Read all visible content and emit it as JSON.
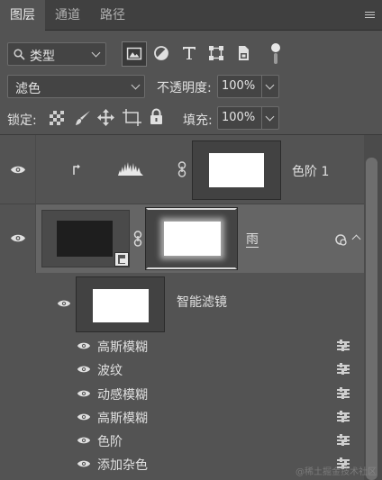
{
  "tabs": [
    {
      "label": "图层"
    },
    {
      "label": "通道"
    },
    {
      "label": "路径"
    }
  ],
  "filter": {
    "icon": "search-icon",
    "type_label": "类型"
  },
  "blend": {
    "mode": "滤色",
    "opacity_label": "不透明度:",
    "opacity_value": "100%"
  },
  "lock": {
    "label": "锁定:",
    "fill_label": "填充:",
    "fill_value": "100%"
  },
  "layers": {
    "levels": {
      "name": "色阶 1"
    },
    "rain": {
      "name": "雨"
    },
    "smart_filters": {
      "label": "智能滤镜"
    }
  },
  "filters": [
    {
      "name": "高斯模糊"
    },
    {
      "name": "波纹"
    },
    {
      "name": "动感模糊"
    },
    {
      "name": "高斯模糊"
    },
    {
      "name": "色阶"
    },
    {
      "name": "添加杂色"
    }
  ],
  "watermark": "@稀土掘金技术社区"
}
